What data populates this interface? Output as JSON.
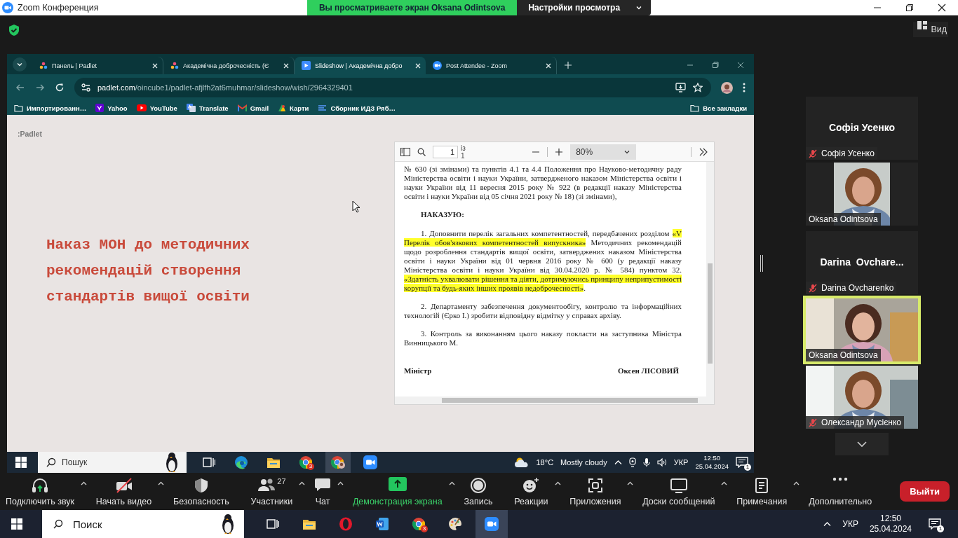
{
  "app_title": "Zoom Конференция",
  "share_banner": {
    "text": "Вы просматриваете экран Oksana Odintsova",
    "settings": "Настройки просмотра"
  },
  "view_button": "Вид",
  "browser": {
    "tabs": [
      {
        "title": "Панель | Padlet",
        "kind": "padlet",
        "selected": false
      },
      {
        "title": "Академічна доброчесність (Є",
        "kind": "padlet",
        "selected": false
      },
      {
        "title": "Slideshow | Академічна добро",
        "kind": "slideshow",
        "selected": true
      },
      {
        "title": "Post Attendee - Zoom",
        "kind": "zoom",
        "selected": false
      }
    ],
    "url_host": "padlet.com",
    "url_path": "/oincube1/padlet-afjlfh2at6muhmar/slideshow/wish/2964329401",
    "bookmarks": [
      {
        "label": "Импортированн…",
        "kind": "folder"
      },
      {
        "label": "Yahoo",
        "kind": "yahoo"
      },
      {
        "label": "YouTube",
        "kind": "youtube"
      },
      {
        "label": "Translate",
        "kind": "translate"
      },
      {
        "label": "Gmail",
        "kind": "gmail"
      },
      {
        "label": "Карти",
        "kind": "maps"
      },
      {
        "label": "Сборник ИДЗ Ряб…",
        "kind": "doc"
      }
    ],
    "all_bookmarks": "Все закладки"
  },
  "slide": {
    "logo": ":Padlet",
    "title": "Наказ МОН до методичних рекомендацій створення стандартів вищої освіти"
  },
  "pdf": {
    "page": "1",
    "page_count": "із 1",
    "zoom": "80%",
    "paragraphs": [
      {
        "kind": "text",
        "segments": [
          {
            "text": "№ 630 (зі змінами) та пунктів 4.1 та 4.4 Положення про Науково-методичну раду Міністерства освіти і науки України, затвердженого наказом Міністерства освіти і науки України від 11 вересня 2015 року № 922 (в редакції наказу Міністерства освіти і науки України від 05 січня 2021 року № 18) (зі змінами),",
            "highlighted": false
          }
        ]
      },
      {
        "kind": "heading",
        "segments": [
          {
            "text": "НАКАЗУЮ:",
            "highlighted": false
          }
        ]
      },
      {
        "kind": "item",
        "segments": [
          {
            "text": "1. Доповнити перелік загальних компетентностей, передбачених розділом ",
            "highlighted": false
          },
          {
            "text": "«V Перелік обов'язкових компетентностей випускника»",
            "highlighted": true
          },
          {
            "text": " Методичних рекомендацій щодо розроблення стандартів вищої освіти, затверджених наказом Міністерства освіти і науки України від 01 червня 2016 року № 600 (у редакції наказу Міністерства освіти і науки України від 30.04.2020 р. № 584) пунктом 32. ",
            "highlighted": false
          },
          {
            "text": "«Здатність ухвалювати рішення та діяти, дотримуючись принципу неприпустимості корупції та будь-яких інших проявів недоброчесності»",
            "highlighted": true
          },
          {
            "text": ".",
            "highlighted": false
          }
        ]
      },
      {
        "kind": "item",
        "segments": [
          {
            "text": "2. Департаменту забезпечення документообігу, контролю та інформаційних технологій (Єрко І.) зробити відповідну відмітку у справах архіву.",
            "highlighted": false
          }
        ]
      },
      {
        "kind": "item",
        "segments": [
          {
            "text": "3. Контроль за виконанням цього наказу покласти на заступника Міністра Винницького М.",
            "highlighted": false
          }
        ]
      }
    ],
    "signature": {
      "position": "Міністр",
      "name": "Оксен ЛІСОВИЙ"
    }
  },
  "shared_taskbar": {
    "search": "Пошук",
    "apps": [
      {
        "kind": "taskview",
        "selected": false
      },
      {
        "kind": "edge",
        "selected": false
      },
      {
        "kind": "folder",
        "selected": false
      },
      {
        "kind": "chrome",
        "badge": "3",
        "selected": false
      },
      {
        "kind": "chromeprofile",
        "selected": true
      },
      {
        "kind": "zoom",
        "selected": false
      }
    ],
    "temperature": "18°C",
    "weather": "Mostly cloudy",
    "language": "УКР",
    "time": "12:50",
    "date": "25.04.2024",
    "notifications": "1"
  },
  "gallery": [
    {
      "kind": "name",
      "heading": "Софія Усенко",
      "name": "Софія Усенко",
      "muted": true,
      "speaking": false
    },
    {
      "kind": "portrait",
      "name": "Oksana Odintsova",
      "muted": false,
      "speaking": false
    },
    {
      "kind": "name",
      "heading": "Darina  Ovchare...",
      "name": "Darina Ovcharenko",
      "muted": true,
      "speaking": false
    },
    {
      "kind": "video",
      "name": "Oksana Odintsova",
      "muted": false,
      "speaking": true
    },
    {
      "kind": "video",
      "name": "Олександр Мусієнко",
      "muted": true,
      "speaking": false
    }
  ],
  "toolbar": [
    {
      "kind": "audio",
      "label": "Подключить звук",
      "caret": true
    },
    {
      "kind": "video",
      "label": "Начать видео",
      "caret": true
    },
    {
      "kind": "security",
      "label": "Безопасность",
      "caret": false
    },
    {
      "kind": "participants",
      "label": "Участники",
      "count": "27",
      "caret": true
    },
    {
      "kind": "chat",
      "label": "Чат",
      "caret": true
    },
    {
      "kind": "share",
      "label": "Демонстрация экрана",
      "caret": true
    },
    {
      "kind": "record",
      "label": "Запись",
      "caret": false
    },
    {
      "kind": "reactions",
      "label": "Реакции",
      "caret": true
    },
    {
      "kind": "apps",
      "label": "Приложения",
      "caret": true
    },
    {
      "kind": "whiteboards",
      "label": "Доски сообщений",
      "caret": true
    },
    {
      "kind": "notes",
      "label": "Примечания",
      "caret": true
    },
    {
      "kind": "more",
      "label": "Дополнительно",
      "caret": false
    }
  ],
  "leave": "Выйти",
  "taskbar": {
    "placeholder": "Поиск",
    "apps": [
      {
        "kind": "taskview",
        "selected": false
      },
      {
        "kind": "folder",
        "selected": false
      },
      {
        "kind": "opera",
        "selected": false
      },
      {
        "kind": "word",
        "selected": false
      },
      {
        "kind": "chrome",
        "badge": "3",
        "selected": false
      },
      {
        "kind": "paint",
        "selected": false
      },
      {
        "kind": "zoom",
        "selected": true
      }
    ],
    "language": "УКР",
    "time": "12:50",
    "date": "25.04.2024",
    "notifications": "1"
  }
}
